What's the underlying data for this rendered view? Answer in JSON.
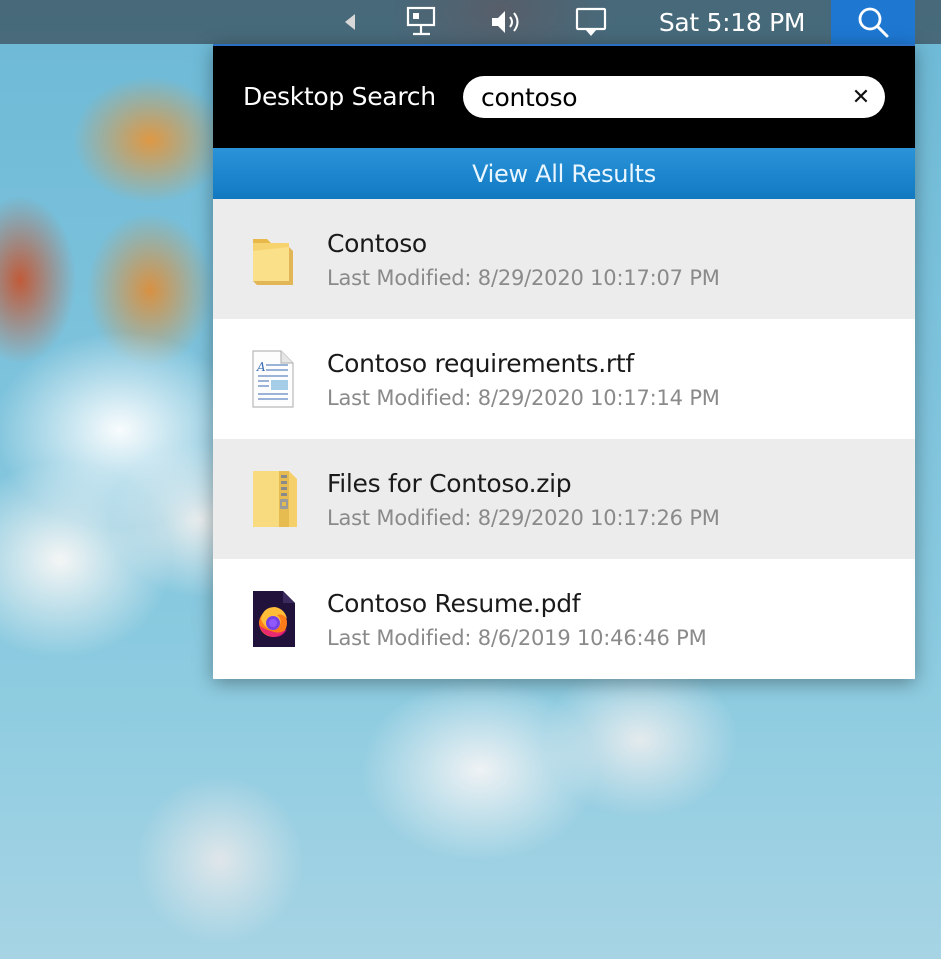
{
  "menubar": {
    "overflow_icon": "left-triangle-icon",
    "network_icon": "network-icon",
    "volume_icon": "volume-icon",
    "display_icon": "display-icon",
    "clock": "Sat 5:18 PM",
    "search_icon": "search-icon",
    "search_active_color": "#1e78d2"
  },
  "search_panel": {
    "title": "Desktop Search",
    "query": "contoso",
    "clear_icon": "close-icon",
    "clear_glyph": "✕",
    "view_all_label": "View All Results",
    "accent_color": "#1a84cc"
  },
  "results": [
    {
      "name": "Contoso",
      "modified": "Last Modified: 8/29/2020 10:17:07 PM",
      "icon": "folder-icon"
    },
    {
      "name": "Contoso requirements.rtf",
      "modified": "Last Modified: 8/29/2020 10:17:14 PM",
      "icon": "rtf-document-icon"
    },
    {
      "name": "Files for Contoso.zip",
      "modified": "Last Modified: 8/29/2020 10:17:26 PM",
      "icon": "zip-folder-icon"
    },
    {
      "name": "Contoso Resume.pdf",
      "modified": "Last Modified: 8/6/2019 10:46:46 PM",
      "icon": "firefox-pdf-icon"
    }
  ]
}
